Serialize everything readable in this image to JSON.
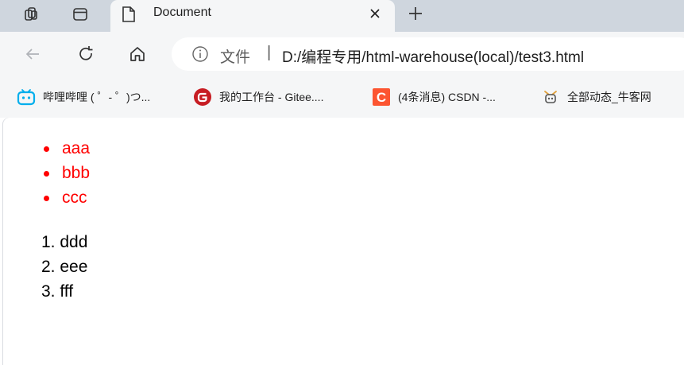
{
  "browser": {
    "tab": {
      "title": "Document"
    },
    "address": {
      "info_icon": "info-icon",
      "file_label": "文件",
      "separator": "|",
      "url": "D:/编程专用/html-warehouse(local)/test3.html"
    },
    "bookmarks": [
      {
        "label": "哔哩哔哩 ( ゜- ゜)つ...",
        "icon": "bilibili-icon",
        "color": "#00aeec"
      },
      {
        "label": "我的工作台 - Gitee....",
        "icon": "gitee-icon",
        "color": "#c71d23"
      },
      {
        "label": "(4条消息) CSDN -...",
        "icon": "csdn-icon",
        "color": "#fc5531"
      },
      {
        "label": "全部动态_牛客网",
        "icon": "nowcoder-icon",
        "color": "#e2a13a"
      }
    ]
  },
  "page": {
    "unordered_list": {
      "color": "#ff0000",
      "items": [
        "aaa",
        "bbb",
        "ccc"
      ]
    },
    "ordered_list": {
      "items": [
        "1. ddd",
        "2. eee",
        "3. fff"
      ]
    }
  }
}
